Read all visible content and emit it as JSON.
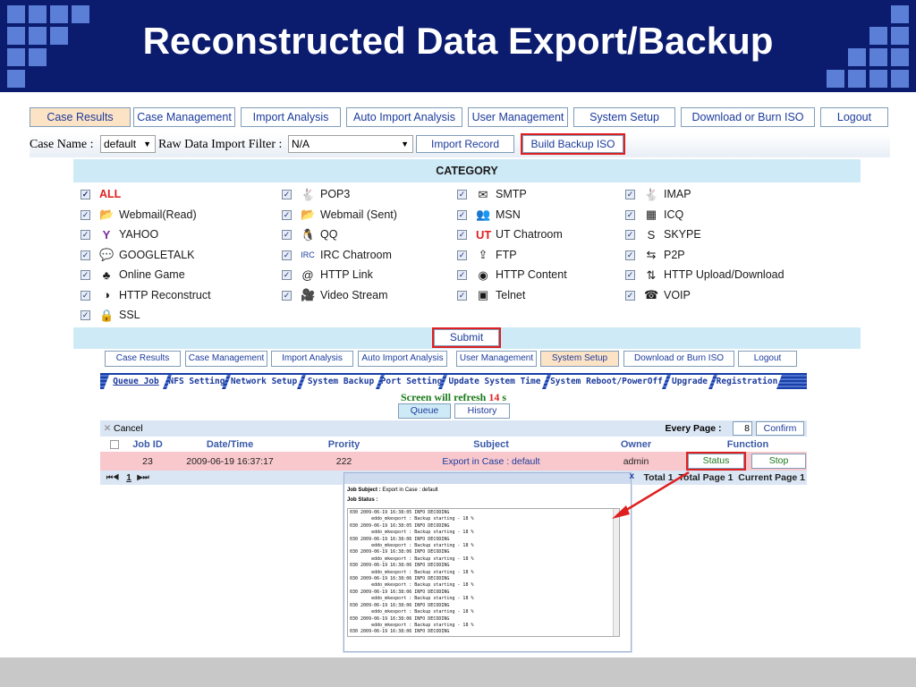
{
  "slide": {
    "title": "Reconstructed Data Export/Backup"
  },
  "nav_top": [
    {
      "label": "Case Results",
      "active": true
    },
    {
      "label": "Case Management"
    },
    {
      "label": "Import Analysis"
    },
    {
      "label": "Auto Import Analysis"
    },
    {
      "label": "User Management"
    },
    {
      "label": "System Setup"
    },
    {
      "label": "Download or Burn ISO"
    },
    {
      "label": "Logout"
    }
  ],
  "case_row": {
    "case_name_label": "Case Name :",
    "case_name_value": "default",
    "filter_label": "Raw Data Import Filter :",
    "filter_value": "N/A",
    "import_record": "Import Record",
    "build_backup": "Build Backup ISO"
  },
  "category": {
    "title": "CATEGORY",
    "items": [
      {
        "label": "ALL",
        "icon": "none",
        "checked": true,
        "highlight": "#e02020"
      },
      {
        "label": "POP3",
        "icon": "pop3-icon",
        "checked": true
      },
      {
        "label": "SMTP",
        "icon": "smtp-icon",
        "checked": true
      },
      {
        "label": "IMAP",
        "icon": "imap-icon",
        "checked": true
      },
      {
        "label": "Webmail(Read)",
        "icon": "webmail-read-icon",
        "checked": true
      },
      {
        "label": "Webmail (Sent)",
        "icon": "webmail-sent-icon",
        "checked": true
      },
      {
        "label": "MSN",
        "icon": "msn-icon",
        "checked": true
      },
      {
        "label": "ICQ",
        "icon": "icq-icon",
        "checked": true
      },
      {
        "label": "YAHOO",
        "icon": "yahoo-icon",
        "checked": true
      },
      {
        "label": "QQ",
        "icon": "qq-icon",
        "checked": true
      },
      {
        "label": "UT Chatroom",
        "icon": "ut-chatroom-icon",
        "checked": true
      },
      {
        "label": "SKYPE",
        "icon": "skype-icon",
        "checked": true
      },
      {
        "label": "GOOGLETALK",
        "icon": "googletalk-icon",
        "checked": true
      },
      {
        "label": "IRC Chatroom",
        "icon": "irc-icon",
        "checked": true
      },
      {
        "label": "FTP",
        "icon": "ftp-icon",
        "checked": true
      },
      {
        "label": "P2P",
        "icon": "p2p-icon",
        "checked": true
      },
      {
        "label": "Online Game",
        "icon": "online-game-icon",
        "checked": true
      },
      {
        "label": "HTTP Link",
        "icon": "http-link-icon",
        "checked": true
      },
      {
        "label": "HTTP Content",
        "icon": "http-content-icon",
        "checked": true
      },
      {
        "label": "HTTP Upload/Download",
        "icon": "http-upload-icon",
        "checked": true
      },
      {
        "label": "HTTP Reconstruct",
        "icon": "http-reconstruct-icon",
        "checked": true
      },
      {
        "label": "Video Stream",
        "icon": "video-stream-icon",
        "checked": true
      },
      {
        "label": "Telnet",
        "icon": "telnet-icon",
        "checked": true
      },
      {
        "label": "VOIP",
        "icon": "voip-icon",
        "checked": true
      },
      {
        "label": "SSL",
        "icon": "ssl-icon",
        "checked": true
      }
    ],
    "submit": "Submit"
  },
  "nav_inner": [
    {
      "label": "Case Results"
    },
    {
      "label": "Case Management"
    },
    {
      "label": "Import Analysis"
    },
    {
      "label": "Auto Import Analysis"
    },
    {
      "label": "User Management"
    },
    {
      "label": "System Setup",
      "active": true
    },
    {
      "label": "Download or Burn ISO"
    },
    {
      "label": "Logout"
    }
  ],
  "setup_tabs": [
    {
      "label": "Queue Job",
      "active": true
    },
    {
      "label": "NFS Setting"
    },
    {
      "label": "Network Setup"
    },
    {
      "label": "System Backup"
    },
    {
      "label": "Port Setting"
    },
    {
      "label": "Update System Time"
    },
    {
      "label": "System Reboot/PowerOff"
    },
    {
      "label": "Upgrade"
    },
    {
      "label": "Registration"
    }
  ],
  "refresh": {
    "prefix": "Screen will refresh",
    "seconds": "14",
    "suffix": "s"
  },
  "queue_tabs": {
    "queue": "Queue",
    "history": "History"
  },
  "grid": {
    "cancel": "Cancel",
    "every_page_label": "Every Page :",
    "every_page_value": "8",
    "confirm": "Confirm",
    "headers": [
      "Job ID",
      "Date/Time",
      "Prority",
      "Subject",
      "Owner",
      "Function"
    ],
    "row": {
      "job_id": "23",
      "datetime": "2009-06-19 16:37:17",
      "priority": "222",
      "subject": "Export in Case : default",
      "owner": "admin",
      "status_btn": "Status",
      "stop_btn": "Stop"
    },
    "pager": {
      "prev": "⏮◀",
      "page": "1",
      "next": "▶⏭"
    },
    "footer": "Total 1  Total Page 1  Current Page 1"
  },
  "popup": {
    "subject_label": "Job Subject :",
    "subject_value": "Export in Case : default",
    "status_label": "Job Status :",
    "close": "x",
    "log_lines": [
      "030 2009-06-19 16:38:05 INFO DECODING",
      "        eddo_mkexport : Backup starting - 18 %",
      "030 2009-06-19 16:38:05 INFO DECODING",
      "        eddo_mkexport : Backup starting - 18 %",
      "030 2009-06-19 16:38:06 INFO DECODING",
      "        eddo_mkexport : Backup starting - 18 %",
      "030 2009-06-19 16:38:06 INFO DECODING",
      "        eddo_mkexport : Backup starting - 18 %",
      "030 2009-06-19 16:38:06 INFO DECODING",
      "        eddo_mkexport : Backup starting - 18 %",
      "030 2009-06-19 16:38:06 INFO DECODING",
      "        eddo_mkexport : Backup starting - 18 %",
      "030 2009-06-19 16:38:06 INFO DECODING",
      "        eddo_mkexport : Backup starting - 18 %",
      "030 2009-06-19 16:38:06 INFO DECODING",
      "        eddo_mkexport : Backup starting - 18 %",
      "030 2009-06-19 16:38:06 INFO DECODING",
      "        eddo_mkexport : Backup starting - 18 %",
      "030 2009-06-19 16:38:06 INFO DECODING",
      "        eddo_mkexport : Backup starting - 18 %"
    ]
  }
}
